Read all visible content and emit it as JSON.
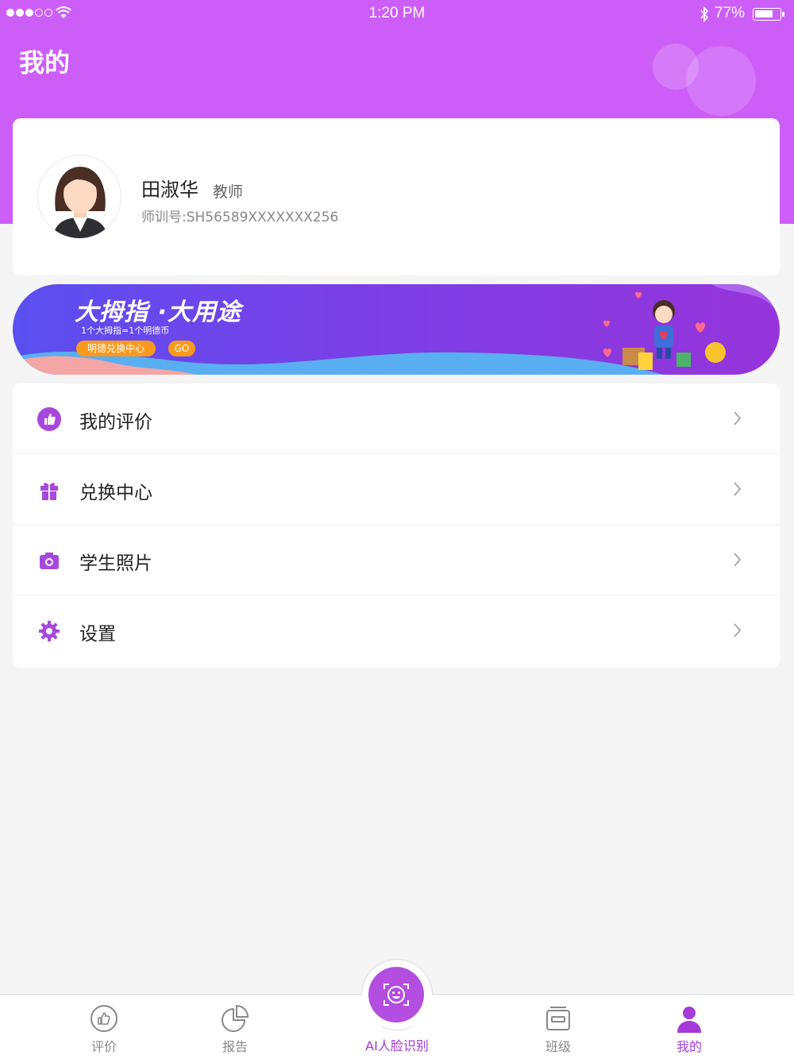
{
  "status_bar": {
    "time": "1:20 PM",
    "battery_percent": "77%",
    "battery_level": 0.77
  },
  "header": {
    "title": "我的"
  },
  "profile": {
    "name": "田淑华",
    "role": "教师",
    "id_text": "师训号:SH56589XXXXXXX256"
  },
  "banner": {
    "title": "大拇指 ·大用途",
    "subtitle": "1个大拇指=1个明德币",
    "pill": "明德兑换中心",
    "go": "GO"
  },
  "menu": [
    {
      "label": "我的评价",
      "icon": "thumbs-up-icon"
    },
    {
      "label": "兑换中心",
      "icon": "gift-icon"
    },
    {
      "label": "学生照片",
      "icon": "camera-icon"
    },
    {
      "label": "设置",
      "icon": "gear-icon"
    }
  ],
  "tabbar": {
    "tabs": [
      {
        "label": "评价",
        "icon": "thumbs-up-outline-icon"
      },
      {
        "label": "报告",
        "icon": "pie-chart-icon"
      },
      {
        "label": "AI人脸识别",
        "icon": "face-scan-icon"
      },
      {
        "label": "班级",
        "icon": "class-icon"
      },
      {
        "label": "我的",
        "icon": "person-icon"
      }
    ],
    "active": "我的"
  },
  "colors": {
    "accent": "#cc5ef7",
    "tab_active": "#a53ad9",
    "banner_orange": "#f99a1e"
  }
}
